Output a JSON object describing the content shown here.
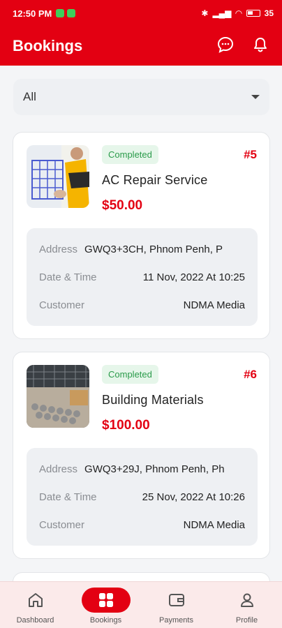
{
  "status_bar": {
    "time": "12:50 PM",
    "battery": "35"
  },
  "header": {
    "title": "Bookings",
    "icons": [
      "chat-icon",
      "bell-icon"
    ]
  },
  "filter": {
    "selected": "All"
  },
  "bookings": [
    {
      "status": "Completed",
      "number": "#5",
      "service": "AC Repair Service",
      "price": "$50.00",
      "address_label": "Address",
      "address": "GWQ3+3CH, Phnom Penh, P",
      "datetime_label": "Date & Time",
      "datetime": "11 Nov, 2022 At 10:25",
      "customer_label": "Customer",
      "customer": "NDMA Media"
    },
    {
      "status": "Completed",
      "number": "#6",
      "service": "Building Materials",
      "price": "$100.00",
      "address_label": "Address",
      "address": "GWQ3+29J, Phnom Penh, Ph",
      "datetime_label": "Date & Time",
      "datetime": "25 Nov, 2022 At 10:26",
      "customer_label": "Customer",
      "customer": "NDMA Media"
    }
  ],
  "bottom_nav": [
    {
      "label": "Dashboard",
      "icon": "home-icon"
    },
    {
      "label": "Bookings",
      "icon": "bookings-icon",
      "active": true
    },
    {
      "label": "Payments",
      "icon": "wallet-icon"
    },
    {
      "label": "Profile",
      "icon": "profile-icon"
    }
  ],
  "colors": {
    "primary": "#e30012",
    "success_text": "#2a9b4a",
    "success_bg": "#e6f6ea"
  }
}
